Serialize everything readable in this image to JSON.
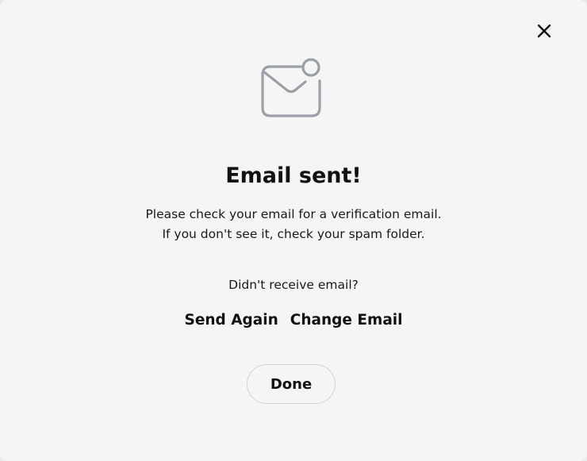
{
  "dialog": {
    "title": "Email sent!",
    "message_line1": "Please check your email for a verification email.",
    "message_line2": "If you don't see it, check your spam folder.",
    "prompt": "Didn't receive email?",
    "send_again_label": "Send Again",
    "change_email_label": "Change Email",
    "done_label": "Done"
  },
  "icons": {
    "close": "close-icon",
    "hero": "mail-notification-icon"
  },
  "colors": {
    "background": "#f5f5f5",
    "text": "#111111",
    "icon": "#9aa0a6",
    "button_border": "#d4d4d4"
  }
}
